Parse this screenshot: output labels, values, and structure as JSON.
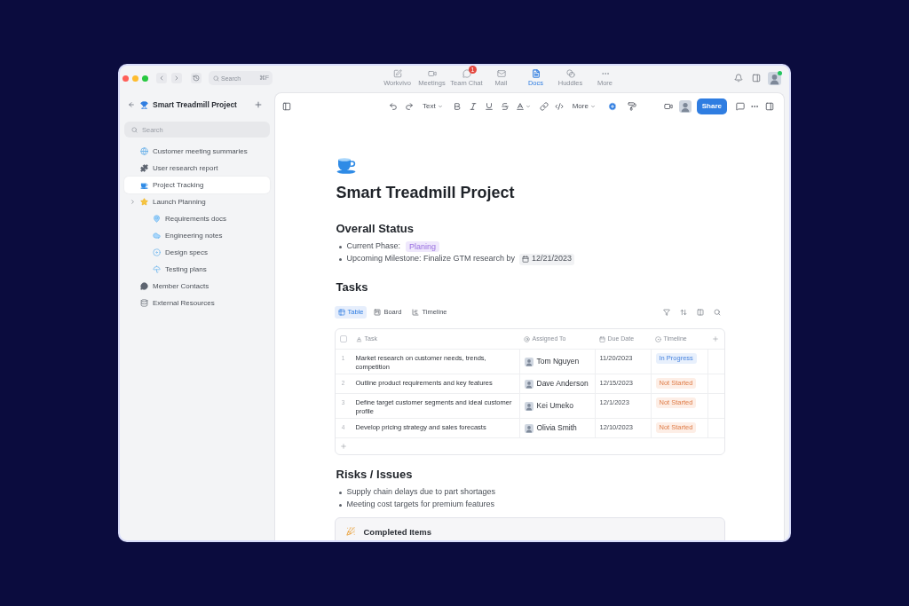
{
  "top_bar": {
    "search": {
      "placeholder": "Search",
      "shortcut": "⌘F"
    },
    "nav": [
      {
        "label": "Workvivo",
        "selected": false
      },
      {
        "label": "Meetings",
        "selected": false
      },
      {
        "label": "Team Chat",
        "selected": false,
        "badge": "1"
      },
      {
        "label": "Mail",
        "selected": false
      },
      {
        "label": "Docs",
        "selected": true
      },
      {
        "label": "Huddles",
        "selected": false
      },
      {
        "label": "More",
        "selected": false
      }
    ],
    "user": {
      "online": true
    }
  },
  "sidebar": {
    "title": "Smart Treadmill Project",
    "search": {
      "placeholder": "Search"
    },
    "items": [
      {
        "label": "Customer meeting summaries",
        "selected": false
      },
      {
        "label": "User research report",
        "selected": false
      },
      {
        "label": "Project Tracking",
        "selected": true
      },
      {
        "label": "Launch Planning",
        "selected": false,
        "children": [
          {
            "label": "Requirements docs",
            "selected": false
          },
          {
            "label": "Engineering notes",
            "selected": false
          },
          {
            "label": "Design specs",
            "selected": false
          },
          {
            "label": "Testing plans",
            "selected": false
          }
        ]
      },
      {
        "label": "Member Contacts",
        "selected": false
      },
      {
        "label": "External Resources",
        "selected": false
      }
    ]
  },
  "toolbar": {
    "text_style": "Text",
    "more": "More",
    "share": "Share"
  },
  "document": {
    "title": "Smart Treadmill Project",
    "overall_status": {
      "heading": "Overall Status",
      "bullets": [
        {
          "text": "Current Phase:",
          "tag": "Planing"
        },
        {
          "text": "Upcoming Milestone: Finalize GTM research by",
          "date": "12/21/2023"
        }
      ]
    },
    "tasks": {
      "heading": "Tasks",
      "views": [
        {
          "label": "Table",
          "selected": true
        },
        {
          "label": "Board",
          "selected": false
        },
        {
          "label": "Timeline",
          "selected": false
        }
      ],
      "table": {
        "select_all_checked": false,
        "columns": [
          "Task",
          "Assigned To",
          "Due Date",
          "Timeline"
        ],
        "rows": [
          {
            "number": "1",
            "task": "Market research on customer needs, trends, competition",
            "assignee": "Tom Nguyen",
            "due": "11/20/2023",
            "status": {
              "label": "In Progress",
              "color": "#e8f0fc"
            }
          },
          {
            "number": "2",
            "task": "Outline product requirements and key features",
            "assignee": "Dave Anderson",
            "due": "12/15/2023",
            "status": {
              "label": "Not Started",
              "color": "#fdeee6"
            }
          },
          {
            "number": "3",
            "task": "Define target customer segments and ideal customer profile",
            "assignee": "Kei Umeko",
            "due": "12/1/2023",
            "status": {
              "label": "Not Started",
              "color": "#fdeee6"
            }
          },
          {
            "number": "4",
            "task": "Develop pricing strategy and sales forecasts",
            "assignee": "Olivia Smith",
            "due": "12/10/2023",
            "status": {
              "label": "Not Started",
              "color": "#fdeee6"
            }
          }
        ]
      }
    },
    "risks": {
      "heading": "Risks / Issues",
      "bullets": [
        "Supply chain delays due to part shortages",
        "Meeting cost targets for premium features"
      ]
    },
    "completed": {
      "title": "Completed Items"
    }
  }
}
